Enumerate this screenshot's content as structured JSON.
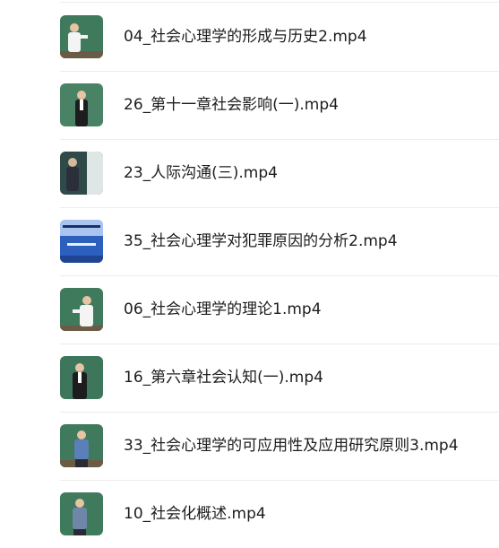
{
  "videos": {
    "items": [
      {
        "title": "04_社会心理学的形成与历史2.mp4",
        "thumb": "lecture-green"
      },
      {
        "title": "26_第十一章社会影响(一).mp4",
        "thumb": "lecture-green"
      },
      {
        "title": "23_人际沟通(三).mp4",
        "thumb": "lecture-dark"
      },
      {
        "title": "35_社会心理学对犯罪原因的分析2.mp4",
        "thumb": "slide-blue"
      },
      {
        "title": "06_社会心理学的理论1.mp4",
        "thumb": "lecture-green"
      },
      {
        "title": "16_第六章社会认知(一).mp4",
        "thumb": "lecture-green"
      },
      {
        "title": "33_社会心理学的可应用性及应用研究原则3.mp4",
        "thumb": "lecture-green"
      },
      {
        "title": "10_社会化概述.mp4",
        "thumb": "lecture-green"
      }
    ]
  },
  "colors": {
    "board_green": "#3f7a5c",
    "text": "#1d1d1f",
    "divider": "#ececec",
    "slide_blue": "#2d5fbf"
  }
}
